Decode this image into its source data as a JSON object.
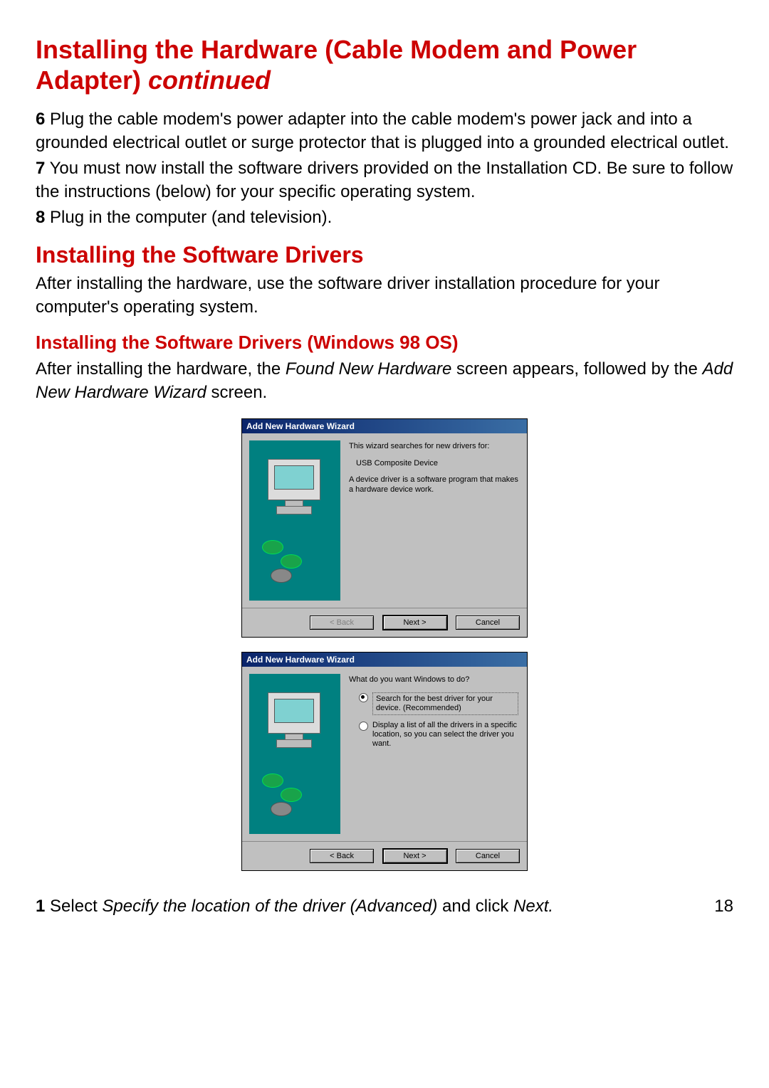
{
  "headings": {
    "h1_a": "Installing the Hardware (Cable Modem and Power Adapter) ",
    "h1_b": "continued",
    "h2": "Installing the Software Drivers",
    "h3": "Installing the Software Drivers (Windows 98 OS)"
  },
  "steps": {
    "n6": "6",
    "t6": " Plug the cable modem's power adapter into the cable modem's power jack and into a grounded electrical outlet or surge protector that is plugged into a grounded electrical outlet.",
    "n7": "7",
    "t7": " You must now install the software drivers provided on the Installation CD. Be sure to follow the instructions (below) for your specific operating system.",
    "n8": "8",
    "t8": " Plug in the computer (and television)."
  },
  "para1": "After installing the hardware, use the software driver installation procedure for your computer's operating system.",
  "para2_a": "After installing the hardware, the ",
  "para2_b": "Found New Hardware",
  "para2_c": " screen appears, followed by the ",
  "para2_d": "Add New Hardware Wizard ",
  "para2_e": "screen.",
  "dialog1": {
    "title": "Add New Hardware Wizard",
    "l1": "This wizard searches for new drivers for:",
    "l2": "USB Composite Device",
    "l3": "A device driver is a software program that makes a hardware device work.",
    "back": "< Back",
    "next": "Next >",
    "cancel": "Cancel"
  },
  "dialog2": {
    "title": "Add New Hardware Wizard",
    "q": "What do you want Windows to do?",
    "opt1": "Search for the best driver for your device. (Recommended)",
    "opt2": "Display a list of all the drivers in a specific location, so you can select the driver you want.",
    "back": "< Back",
    "next": "Next >",
    "cancel": "Cancel"
  },
  "footer": {
    "n1": "1",
    "t1a": " Select ",
    "t1b": "Specify the location of the driver (Advanced)",
    "t1c": " and click ",
    "t1d": "Next.",
    "page": "18"
  }
}
